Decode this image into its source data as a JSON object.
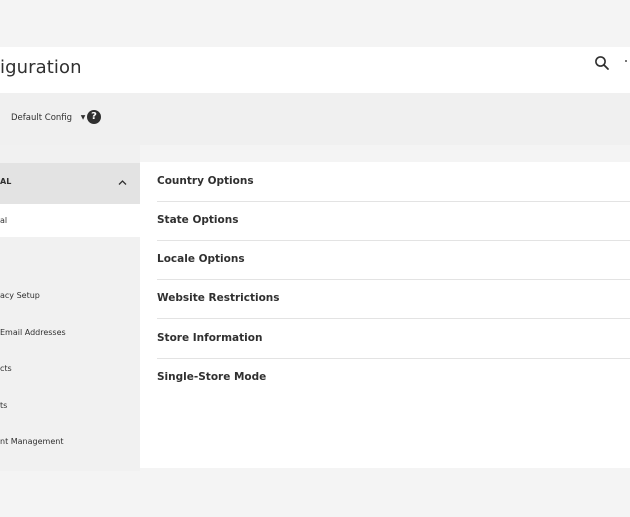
{
  "header": {
    "page_title": "iguration"
  },
  "scope": {
    "switcher_label": "Default Config",
    "caret_glyph": "▼",
    "help_glyph": "?"
  },
  "sidebar": {
    "section_title": "AL",
    "items": [
      {
        "label": "al",
        "active": true
      },
      {
        "label": "",
        "active": false
      },
      {
        "label": "acy Setup",
        "active": false
      },
      {
        "label": "Email Addresses",
        "active": false
      },
      {
        "label": "cts",
        "active": false
      },
      {
        "label": "ts",
        "active": false
      },
      {
        "label": "nt Management",
        "active": false
      }
    ]
  },
  "main": {
    "groups": [
      {
        "label": "Country Options"
      },
      {
        "label": "State Options"
      },
      {
        "label": "Locale Options"
      },
      {
        "label": "Website Restrictions"
      },
      {
        "label": "Store Information"
      },
      {
        "label": "Single-Store Mode"
      }
    ]
  },
  "colors": {
    "page_bg": "#f4f4f4",
    "panel_bg": "#ffffff",
    "sidebar_bg": "#f1f1f1",
    "section_header_bg": "#e3e3e3",
    "divider": "#e3e3e3",
    "text": "#303030"
  },
  "icons": {
    "search": "search-icon",
    "help": "help-icon",
    "section_toggle": "chevron-up-icon"
  }
}
